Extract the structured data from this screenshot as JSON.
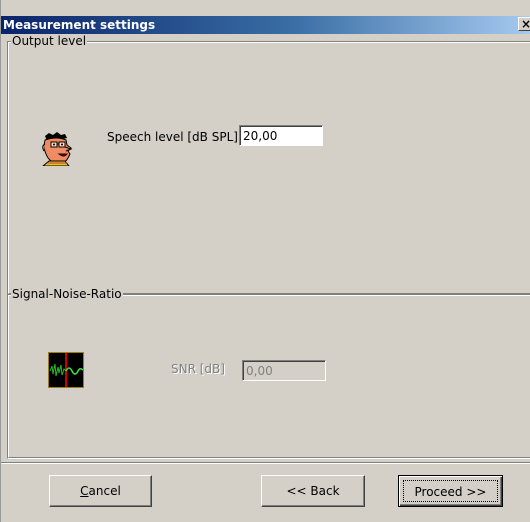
{
  "window": {
    "title": "Measurement settings",
    "close_glyph": "×"
  },
  "output_level": {
    "legend": "Output level",
    "icon": "speaker-face-icon",
    "label": "Speech level [dB SPL]",
    "value": "20,00"
  },
  "snr": {
    "legend": "Signal-Noise-Ratio",
    "icon": "signal-noise-icon",
    "label": "SNR [dB]",
    "value": "0,00",
    "enabled": false
  },
  "buttons": {
    "cancel_accel": "C",
    "cancel_rest": "ancel",
    "back": "<< Back",
    "proceed": "Proceed >>"
  },
  "colors": {
    "titlebar_start": "#0a246a",
    "titlebar_end": "#a6caf0",
    "face": "#d4d0c8"
  }
}
